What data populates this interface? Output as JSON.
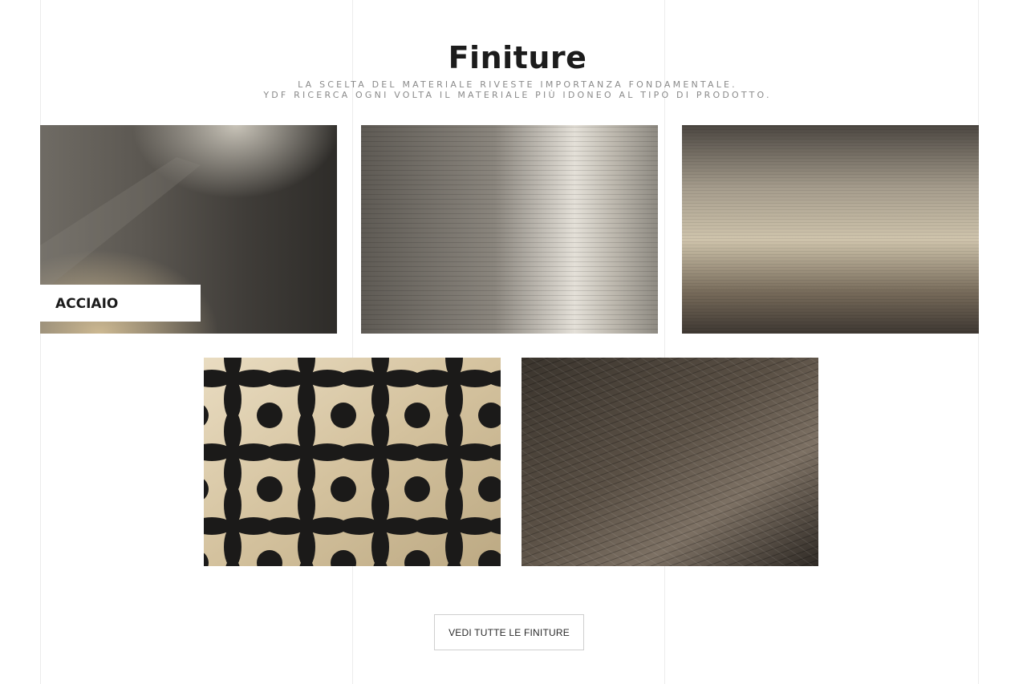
{
  "section": {
    "title": "Finiture",
    "subtitle_line1": "La scelta del materiale riveste importanza fondamentale.",
    "subtitle_line2": "YDF ricerca ogni volta il materiale più idoneo al tipo di prodotto."
  },
  "finishes": [
    {
      "label": "ACCIAIO"
    }
  ],
  "cta": {
    "label": "VEDI TUTTE LE FINITURE"
  }
}
